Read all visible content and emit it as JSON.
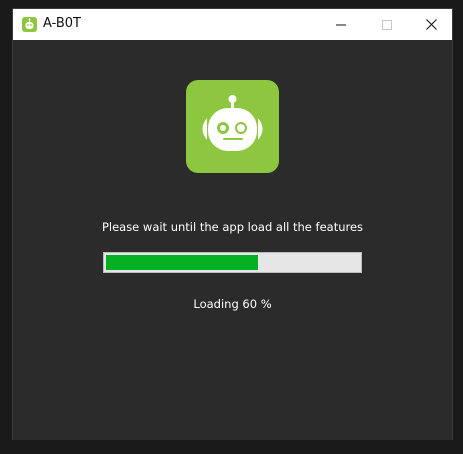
{
  "window": {
    "title": "A-B0T",
    "icon": "robot-icon",
    "controls": {
      "minimize_icon": "minimize-icon",
      "maximize_icon": "maximize-icon",
      "close_icon": "close-icon"
    }
  },
  "splash": {
    "logo_icon": "robot-icon",
    "message": "Please wait until the app load all the features",
    "progress": {
      "percent": 60,
      "fill_color": "#06b025",
      "track_color": "#e6e6e6"
    },
    "status_text": "Loading 60 %"
  },
  "colors": {
    "brand_green": "#8dc63f",
    "background": "#2b2b2b",
    "titlebar": "#ffffff"
  }
}
